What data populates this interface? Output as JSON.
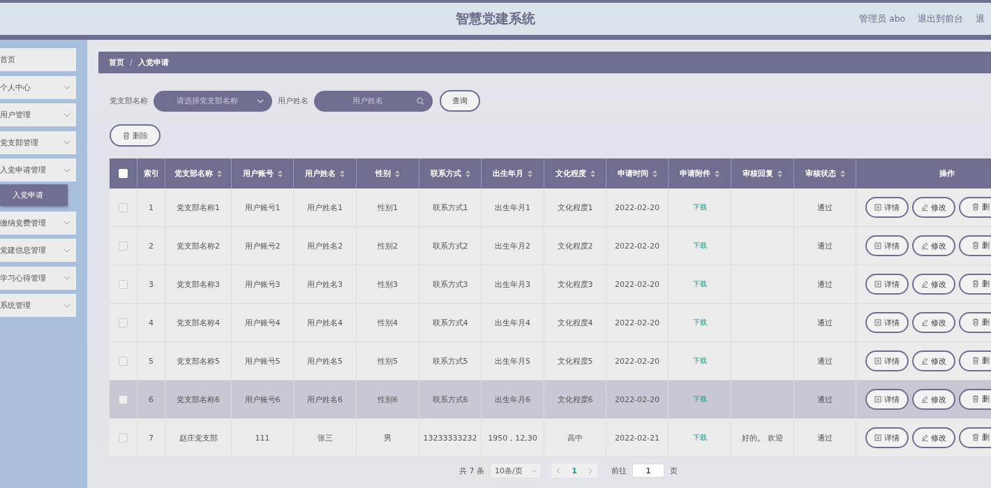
{
  "header": {
    "title": "智慧党建系统",
    "user": "管理员 abo",
    "links": [
      "退出到前台",
      "退"
    ]
  },
  "sidebar": {
    "items": [
      {
        "label": "首页",
        "expandable": false
      },
      {
        "label": "个人中心",
        "expandable": true
      },
      {
        "label": "用户管理",
        "expandable": true
      },
      {
        "label": "党支部管理",
        "expandable": true
      },
      {
        "label": "入党申请管理",
        "expandable": true,
        "children": [
          {
            "label": "入党申请",
            "selected": true
          }
        ]
      },
      {
        "label": "缴纳党费管理",
        "expandable": true
      },
      {
        "label": "党建信息管理",
        "expandable": true
      },
      {
        "label": "学习心得管理",
        "expandable": true
      },
      {
        "label": "系统管理",
        "expandable": true
      }
    ]
  },
  "breadcrumb": {
    "separator": "/",
    "items": [
      "首页",
      "入党申请"
    ]
  },
  "filters": [
    {
      "label": "党支部名称",
      "kind": "select",
      "placeholder": "请选择党支部名称"
    },
    {
      "label": "用户姓名",
      "kind": "search",
      "placeholder": "用户姓名"
    }
  ],
  "query_button": "查询",
  "delete_button": "删除",
  "table": {
    "header_checked": false,
    "columns": [
      {
        "label": "索引",
        "sortable": false
      },
      {
        "label": "党支部名称",
        "sortable": true
      },
      {
        "label": "用户账号",
        "sortable": true
      },
      {
        "label": "用户姓名",
        "sortable": true
      },
      {
        "label": "性别",
        "sortable": true
      },
      {
        "label": "联系方式",
        "sortable": true
      },
      {
        "label": "出生年月",
        "sortable": true
      },
      {
        "label": "文化程度",
        "sortable": true
      },
      {
        "label": "申请时间",
        "sortable": true
      },
      {
        "label": "申请附件",
        "sortable": true
      },
      {
        "label": "审核回复",
        "sortable": true
      },
      {
        "label": "审核状态",
        "sortable": true
      },
      {
        "label": "操作",
        "sortable": false
      }
    ],
    "rows": [
      {
        "checked": false,
        "highlighted": false,
        "cells": [
          "1",
          "党支部名称1",
          "用户账号1",
          "用户姓名1",
          "性别1",
          "联系方式1",
          "出生年月1",
          "文化程度1",
          "2022-02-20",
          "下载",
          null,
          "通过"
        ],
        "actions": [
          {
            "kind": "detail",
            "label": "详情"
          },
          {
            "kind": "edit",
            "label": "修改"
          },
          {
            "kind": "delete",
            "label": "删"
          }
        ]
      },
      {
        "checked": false,
        "highlighted": false,
        "cells": [
          "2",
          "党支部名称2",
          "用户账号2",
          "用户姓名2",
          "性别2",
          "联系方式2",
          "出生年月2",
          "文化程度2",
          "2022-02-20",
          "下载",
          null,
          "通过"
        ],
        "actions": [
          {
            "kind": "detail",
            "label": "详情"
          },
          {
            "kind": "edit",
            "label": "修改"
          },
          {
            "kind": "delete",
            "label": "删"
          }
        ]
      },
      {
        "checked": false,
        "highlighted": false,
        "cells": [
          "3",
          "党支部名称3",
          "用户账号3",
          "用户姓名3",
          "性别3",
          "联系方式3",
          "出生年月3",
          "文化程度3",
          "2022-02-20",
          "下载",
          null,
          "通过"
        ],
        "actions": [
          {
            "kind": "detail",
            "label": "详情"
          },
          {
            "kind": "edit",
            "label": "修改"
          },
          {
            "kind": "delete",
            "label": "删"
          }
        ]
      },
      {
        "checked": false,
        "highlighted": false,
        "cells": [
          "4",
          "党支部名称4",
          "用户账号4",
          "用户姓名4",
          "性别4",
          "联系方式4",
          "出生年月4",
          "文化程度4",
          "2022-02-20",
          "下载",
          null,
          "通过"
        ],
        "actions": [
          {
            "kind": "detail",
            "label": "详情"
          },
          {
            "kind": "edit",
            "label": "修改"
          },
          {
            "kind": "delete",
            "label": "删"
          }
        ]
      },
      {
        "checked": false,
        "highlighted": false,
        "cells": [
          "5",
          "党支部名称5",
          "用户账号5",
          "用户姓名5",
          "性别5",
          "联系方式5",
          "出生年月5",
          "文化程度5",
          "2022-02-20",
          "下载",
          null,
          "通过"
        ],
        "actions": [
          {
            "kind": "detail",
            "label": "详情"
          },
          {
            "kind": "edit",
            "label": "修改"
          },
          {
            "kind": "delete",
            "label": "删"
          }
        ]
      },
      {
        "checked": false,
        "highlighted": true,
        "cells": [
          "6",
          "党支部名称6",
          "用户账号6",
          "用户姓名6",
          "性别6",
          "联系方式6",
          "出生年月6",
          "文化程度6",
          "2022-02-20",
          "下载",
          null,
          "通过"
        ],
        "actions": [
          {
            "kind": "detail",
            "label": "详情"
          },
          {
            "kind": "edit",
            "label": "修改"
          },
          {
            "kind": "delete",
            "label": "删"
          }
        ]
      },
      {
        "checked": false,
        "highlighted": false,
        "cells": [
          "7",
          "赵庄党支部",
          "111",
          "张三",
          "男",
          "13233333232",
          "1950，12,30",
          "高中",
          "2022-02-21",
          "下载",
          "好的。 欢迎",
          "通过"
        ],
        "actions": [
          {
            "kind": "detail",
            "label": "详情"
          },
          {
            "kind": "edit",
            "label": "修改"
          },
          {
            "kind": "delete",
            "label": "删"
          }
        ]
      }
    ]
  },
  "pagination": {
    "total": "共 7 条",
    "page_size": "10条/页",
    "current_page": "1",
    "goto_label": "前往",
    "goto_value": "1",
    "page_unit": "页"
  }
}
